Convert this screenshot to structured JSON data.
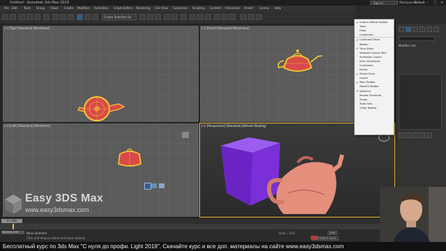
{
  "titlebar": {
    "title": "Untitled - Autodesk 3ds Max 2019",
    "sign_in": "Sign In",
    "workspaces_label": "Workspaces:",
    "workspace_value": "Default"
  },
  "menus": [
    "File",
    "Edit",
    "Tools",
    "Group",
    "Views",
    "Create",
    "Modifiers",
    "Animation",
    "Graph Editors",
    "Rendering",
    "Civil View",
    "Customize",
    "Scripting",
    "Content",
    "Interactive",
    "Arnold",
    "Corona",
    "Help"
  ],
  "toolbar": {
    "selection_set": "Create Selection Se"
  },
  "viewports": {
    "top": "[+] [Top] [Standard] [Wireframe]",
    "front": "[+] [Front] [Standard] [Wireframe]",
    "left": "[+] [Left] [Standard] [Wireframe]",
    "perspective": "[+] [Perspective] [Standard] [Default Shading]"
  },
  "context_menu": {
    "items": [
      {
        "label": "Corona Official Toolbar",
        "checked": true
      },
      {
        "label": "Tools",
        "checked": false
      },
      {
        "label": "Float",
        "checked": false
      },
      {
        "label": "Customize...",
        "checked": false
      },
      {
        "label": "Command Panel",
        "checked": true
      },
      {
        "label": "Ribbon",
        "checked": false
      },
      {
        "label": "Time Slider",
        "checked": true
      },
      {
        "label": "Viewport Layout Tabs",
        "checked": false
      },
      {
        "label": "Animation Layers",
        "checked": false
      },
      {
        "label": "Axis Constraints",
        "checked": false
      },
      {
        "label": "Containers",
        "checked": false
      },
      {
        "label": "Extras",
        "checked": false
      },
      {
        "label": "Parent Track",
        "checked": true
      },
      {
        "label": "Layers",
        "checked": false
      },
      {
        "label": "Main Toolbar",
        "checked": true
      },
      {
        "label": "MassFX Toolbar",
        "checked": false
      },
      {
        "label": "AskDune",
        "checked": true
      },
      {
        "label": "Render Shortcuts",
        "checked": false
      },
      {
        "label": "Snaps",
        "checked": false
      },
      {
        "label": "State Sets",
        "checked": false
      },
      {
        "label": "V-Ray Toolbar",
        "checked": false
      }
    ]
  },
  "command_panel": {
    "modifier_list": "Modifier List"
  },
  "timeline": {
    "slider": "0 / 100"
  },
  "status": {
    "maxscript": "MAXScript Mi:",
    "selected": "None Selected",
    "prompt": "Click and drag to select and move objects",
    "grid": "Grid = 10,0",
    "add_time_tag": "Add Time Tag",
    "auto": "Auto",
    "set_key": "Set K."
  },
  "branding": {
    "name": "Easy 3DS Max",
    "url": "www.easy3dsmax.com"
  },
  "caption": "Бесплатный курс по 3ds Max \"С нуля до профи. Light 2019\". Скачайте курс и все доп. материалы на сайте www.easy3dsmax.com",
  "colors": {
    "teapot_wire": "#f1c232",
    "teapot_fill": "#e58f7d",
    "box": "#7b2fd8",
    "accent": "#1e6fd0"
  }
}
